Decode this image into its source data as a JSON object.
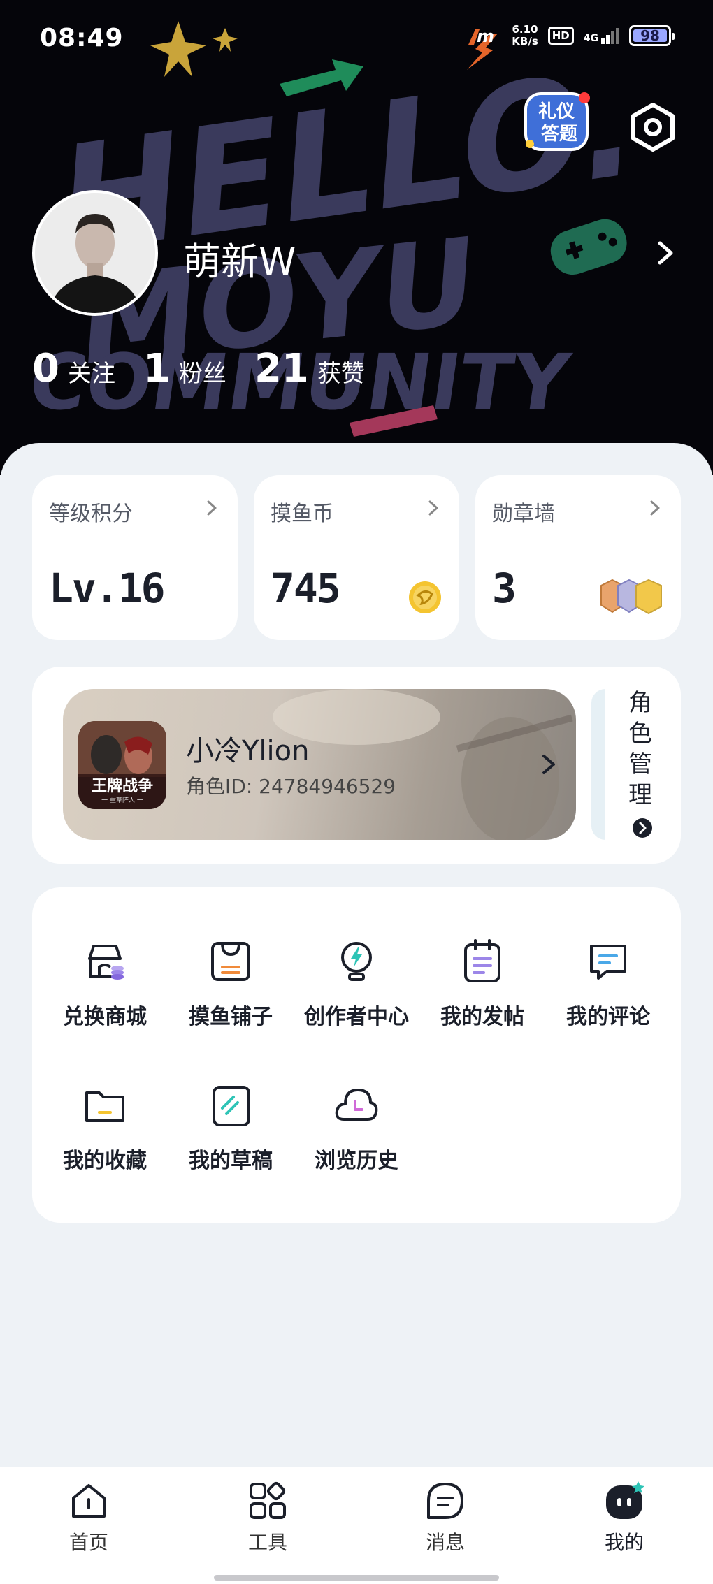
{
  "status_bar": {
    "time": "08:49",
    "net_speed_value": "6.10",
    "net_speed_unit": "KB/s",
    "hd": "HD",
    "network": "4G",
    "battery": "98",
    "battery_level_percent": 98
  },
  "header": {
    "background_text": "HELLO MOYU COMMUNITY",
    "etiquette_badge_line1": "礼仪",
    "etiquette_badge_line2": "答题",
    "settings_icon": "hexagon-gear-icon"
  },
  "profile": {
    "username": "萌新W",
    "stats": [
      {
        "value": "0",
        "label": "关注"
      },
      {
        "value": "1",
        "label": "粉丝"
      },
      {
        "value": "21",
        "label": "获赞"
      }
    ]
  },
  "metrics": [
    {
      "title": "等级积分",
      "value": "Lv.16"
    },
    {
      "title": "摸鱼币",
      "value": "745"
    },
    {
      "title": "勋章墙",
      "value": "3"
    }
  ],
  "role": {
    "game_icon_text": "王牌战争",
    "game_icon_subtext": "一 重草阵人 一",
    "name": "小冷Ylion",
    "id_text": "角色ID: 24784946529",
    "manage_label": "角色管理"
  },
  "tools": [
    {
      "label": "兑换商城",
      "icon": "store-icon"
    },
    {
      "label": "摸鱼铺子",
      "icon": "shop-bag-icon"
    },
    {
      "label": "创作者中心",
      "icon": "lightbulb-icon"
    },
    {
      "label": "我的发帖",
      "icon": "notepad-icon"
    },
    {
      "label": "我的评论",
      "icon": "comment-icon"
    },
    {
      "label": "我的收藏",
      "icon": "folder-icon"
    },
    {
      "label": "我的草稿",
      "icon": "draft-icon"
    },
    {
      "label": "浏览历史",
      "icon": "history-cloud-icon"
    }
  ],
  "bottom_nav": [
    {
      "label": "首页",
      "icon": "home-icon"
    },
    {
      "label": "工具",
      "icon": "tools-grid-icon"
    },
    {
      "label": "消息",
      "icon": "message-icon"
    },
    {
      "label": "我的",
      "icon": "profile-face-icon"
    }
  ],
  "colors": {
    "header_bg": "#05050a",
    "art_purple": "#3a3a5c",
    "page_bg": "#eef2f6",
    "card_bg": "#ffffff",
    "accent_green": "#2ec4b6",
    "coin_yellow": "#f4c430"
  }
}
